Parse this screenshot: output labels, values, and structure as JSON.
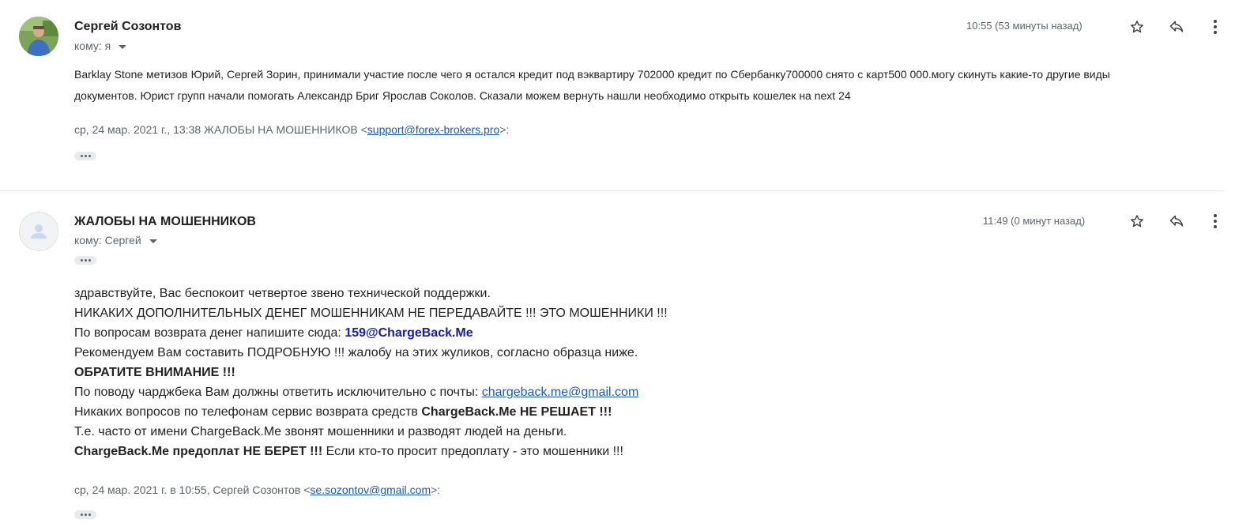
{
  "message1": {
    "sender": "Сергей Созонтов",
    "to_label": "кому: я",
    "time": "10:55 (53 минуты назад)",
    "body": "Barklay Stone  метизов Юрий, Сергей Зорин, принимали участие после чего я остался кредит под вэквартиру  702000 кредит по Сбербанку700000 снято с карт500 000.могу скинуть какие-то другие виды документов. Юрист групп начали помогать Александр Бриг Ярослав Соколов. Сказали можем вернуть нашли необходимо открыть кошелек на next 24",
    "quote_prefix": "ср, 24 мар. 2021 г., 13:38 ЖАЛОБЫ НА МОШЕННИКОВ <",
    "quote_email": "support@forex-brokers.pro",
    "quote_suffix": ">:"
  },
  "message2": {
    "sender": "ЖАЛОБЫ НА МОШЕННИКОВ",
    "to_label": "кому: Сергей",
    "time": "11:49 (0 минут назад)",
    "line1": "здравствуйте, Вас беспокоит четвертое звено технической поддержки.",
    "line2": "НИКАКИХ ДОПОЛНИТЕЛЬНЫХ ДЕНЕГ МОШЕННИКАМ НЕ ПЕРЕДАВАЙТЕ !!! ЭТО МОШЕННИКИ !!!",
    "line3_text": "По вопросам возврата денег напишите сюда: ",
    "line3_email": "159@ChargeBack.Me",
    "line4": "Рекомендуем Вам составить ПОДРОБНУЮ !!! жалобу на этих жуликов, согласно образца ниже.",
    "line5": "ОБРАТИТЕ ВНИМАНИЕ !!!",
    "line6_text": "По поводу чарджбека Вам должны ответить исключительно с почты: ",
    "line6_email": "chargeback.me@gmail.com",
    "line7_text": "Никаких вопросов по телефонам сервис возврата средств ",
    "line7_bold": "ChargeBack.Me НЕ РЕШАЕТ !!!",
    "line8": "Т.е. часто от имени ChargeBack.Me звонят мошенники и разводят людей на деньги.",
    "line9_bold": "ChargeBack.Me предоплат НЕ БЕРЕТ !!!",
    "line9_text": " Если кто-то просит предоплату - это мошенники !!!",
    "quote_prefix": "ср, 24 мар. 2021 г. в 10:55, Сергей Созонтов <",
    "quote_email": "se.sozontov@gmail.com",
    "quote_suffix": ">:"
  },
  "icons": {
    "star": "star-icon",
    "reply": "reply-icon",
    "more": "more-vert-icon",
    "expand": "ellipsis-icon",
    "caret": "chevron-down-icon",
    "avatar_default": "person-icon"
  },
  "colors": {
    "link": "#1a5bb0",
    "accent_email": "#1a1aa6",
    "secondary_text": "#5f6368"
  }
}
